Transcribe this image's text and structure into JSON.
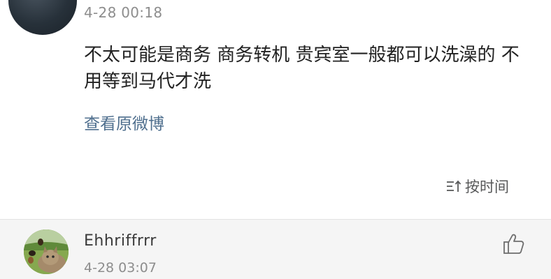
{
  "top_comment": {
    "timestamp": "4-28 00:18",
    "text": "不太可能是商务 商务转机 贵宾室一般都可以洗澡的 不用等到马代才洗",
    "view_original_label": "查看原微博"
  },
  "sort": {
    "label": "按时间",
    "icon": "sort-icon"
  },
  "reply": {
    "username": "Ehhriffrrr",
    "timestamp": "4-28 03:07",
    "like_icon": "thumbs-up-icon"
  },
  "colors": {
    "link": "#4f6f8e",
    "text": "#222222",
    "meta": "#8d8d8d",
    "reply_bg": "#f5f5f5"
  }
}
